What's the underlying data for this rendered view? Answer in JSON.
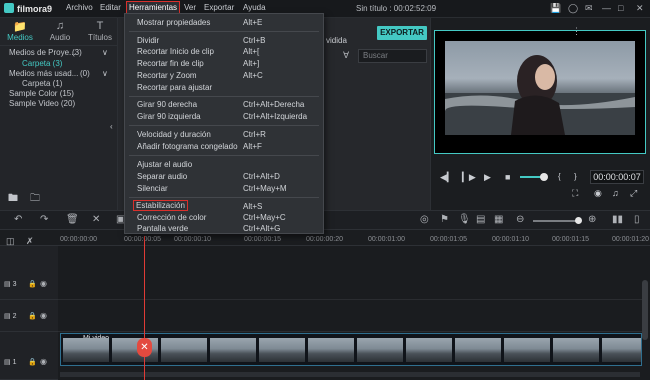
{
  "app": {
    "name": "filmora9",
    "project_title": "Sin título : 00:02:52:09"
  },
  "menubar": [
    "Archivo",
    "Editar",
    "Herramientas",
    "Ver",
    "Exportar",
    "Ayuda"
  ],
  "left_tabs": [
    "Medios",
    "Audio",
    "Títulos"
  ],
  "tree": [
    {
      "label": "Medios de Proye...",
      "count": "(3)"
    },
    {
      "label": "Carpeta (3)",
      "count": ""
    },
    {
      "label": "Medios más usad...",
      "count": "(0)"
    },
    {
      "label": "Carpeta (1)",
      "count": ""
    },
    {
      "label": "Sample Color (15)",
      "count": ""
    },
    {
      "label": "Sample Video (20)",
      "count": ""
    }
  ],
  "export_label": "EXPORTAR",
  "video_tab": "vidida",
  "search_placeholder": "Buscar",
  "menu": [
    {
      "label": "Mostrar propiedades",
      "shortcut": "Alt+E"
    },
    {
      "label": "Dividir",
      "shortcut": "Ctrl+B"
    },
    {
      "label": "Recortar Inicio de clip",
      "shortcut": "Alt+["
    },
    {
      "label": "Recortar fin de clip",
      "shortcut": "Alt+]"
    },
    {
      "label": "Recortar y Zoom",
      "shortcut": "Alt+C"
    },
    {
      "label": "Recortar para ajustar",
      "shortcut": ""
    },
    {
      "label": "Girar 90 derecha",
      "shortcut": "Ctrl+Alt+Derecha"
    },
    {
      "label": "Girar 90 izquierda",
      "shortcut": "Ctrl+Alt+Izquierda"
    },
    {
      "label": "Velocidad y duración",
      "shortcut": "Ctrl+R"
    },
    {
      "label": "Añadir fotograma congelado",
      "shortcut": "Alt+F"
    },
    {
      "label": "Ajustar el audio",
      "shortcut": ""
    },
    {
      "label": "Separar audio",
      "shortcut": "Ctrl+Alt+D"
    },
    {
      "label": "Silenciar",
      "shortcut": "Ctrl+May+M"
    },
    {
      "label": "Estabilización",
      "shortcut": "Alt+S"
    },
    {
      "label": "Corrección de color",
      "shortcut": "Ctrl+May+C"
    },
    {
      "label": "Pantalla verde",
      "shortcut": "Ctrl+Alt+G"
    }
  ],
  "preview_timecode": "00:00:00:07",
  "ruler": [
    "00:00:00:00",
    "00:00:00:05",
    "00:00:00:10",
    "00:00:00:15",
    "00:00:00:20",
    "00:00:01:00",
    "00:00:01:05",
    "00:00:01:10",
    "00:00:01:15",
    "00:00:01:20"
  ],
  "tracks": [
    {
      "num": "3"
    },
    {
      "num": "2"
    },
    {
      "num": "1"
    }
  ],
  "clip_label": "Mi video",
  "colors": {
    "accent": "#44c9c4",
    "highlight": "#d9302c",
    "playhead": "#e03b36"
  }
}
